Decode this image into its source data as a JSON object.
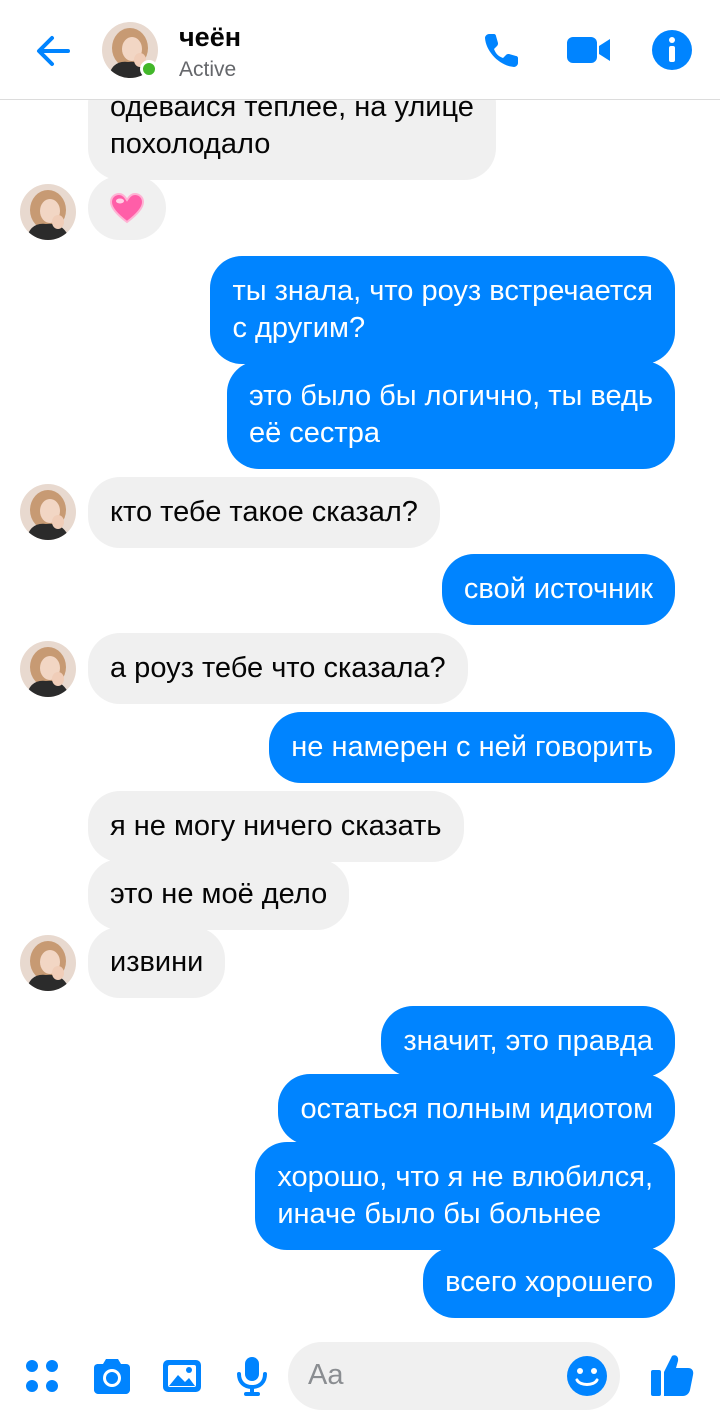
{
  "header": {
    "contact_name": "чеён",
    "status": "Active",
    "icons": [
      "back-arrow-icon",
      "phone-icon",
      "video-camera-icon",
      "info-icon"
    ]
  },
  "colors": {
    "accent": "#0084ff",
    "incoming_bubble": "#f0f0f0",
    "online": "#42b72a"
  },
  "messages": [
    {
      "direction": "in",
      "text_lines": [
        "одевайся теплее, на улице",
        "похолодало"
      ]
    },
    {
      "direction": "in",
      "emoji": "pink-heart"
    },
    {
      "direction": "out",
      "text_lines": [
        "ты знала, что роуз встречается",
        "с другим?"
      ]
    },
    {
      "direction": "out",
      "text_lines": [
        "это было бы логично, ты ведь",
        "её сестра"
      ]
    },
    {
      "direction": "in",
      "text_lines": [
        "кто тебе такое сказал?"
      ]
    },
    {
      "direction": "out",
      "text_lines": [
        "свой источник"
      ]
    },
    {
      "direction": "in",
      "text_lines": [
        "а роуз тебе что сказала?"
      ]
    },
    {
      "direction": "out",
      "text_lines": [
        "не намерен с ней говорить"
      ]
    },
    {
      "direction": "in",
      "text_lines": [
        "я не могу ничего сказать"
      ]
    },
    {
      "direction": "in",
      "text_lines": [
        "это не моё дело"
      ]
    },
    {
      "direction": "in",
      "text_lines": [
        "извини"
      ]
    },
    {
      "direction": "out",
      "text_lines": [
        "значит, это правда"
      ]
    },
    {
      "direction": "out",
      "text_lines": [
        "остаться полным идиотом"
      ]
    },
    {
      "direction": "out",
      "text_lines": [
        "хорошо, что я не влюбился,",
        "иначе было бы больнее"
      ]
    },
    {
      "direction": "out",
      "text_lines": [
        "всего хорошего"
      ]
    }
  ],
  "composer": {
    "placeholder": "Aa",
    "icons": [
      "apps-dots-icon",
      "camera-icon",
      "gallery-icon",
      "microphone-icon",
      "emoji-icon",
      "thumbs-up-icon"
    ]
  }
}
